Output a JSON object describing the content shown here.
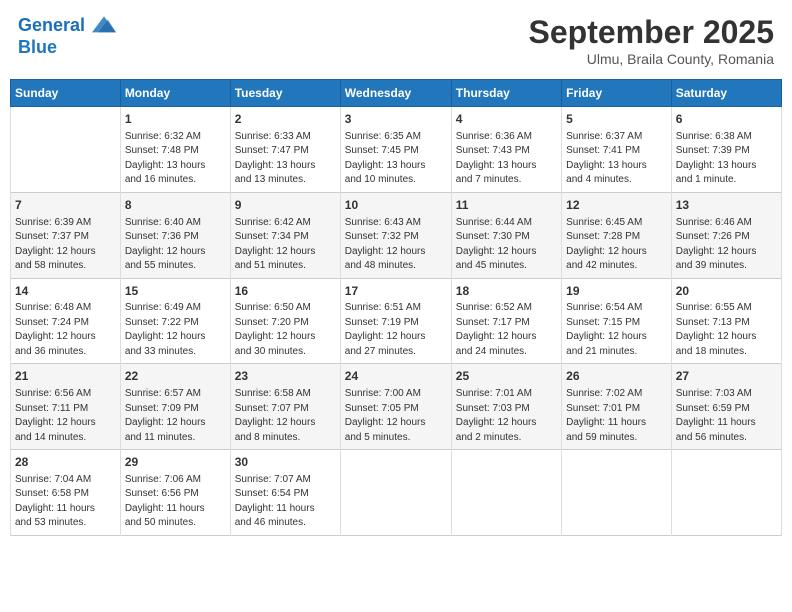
{
  "header": {
    "logo_line1": "General",
    "logo_line2": "Blue",
    "month_title": "September 2025",
    "location": "Ulmu, Braila County, Romania"
  },
  "days_of_week": [
    "Sunday",
    "Monday",
    "Tuesday",
    "Wednesday",
    "Thursday",
    "Friday",
    "Saturday"
  ],
  "weeks": [
    [
      {
        "day": "",
        "info": ""
      },
      {
        "day": "1",
        "info": "Sunrise: 6:32 AM\nSunset: 7:48 PM\nDaylight: 13 hours\nand 16 minutes."
      },
      {
        "day": "2",
        "info": "Sunrise: 6:33 AM\nSunset: 7:47 PM\nDaylight: 13 hours\nand 13 minutes."
      },
      {
        "day": "3",
        "info": "Sunrise: 6:35 AM\nSunset: 7:45 PM\nDaylight: 13 hours\nand 10 minutes."
      },
      {
        "day": "4",
        "info": "Sunrise: 6:36 AM\nSunset: 7:43 PM\nDaylight: 13 hours\nand 7 minutes."
      },
      {
        "day": "5",
        "info": "Sunrise: 6:37 AM\nSunset: 7:41 PM\nDaylight: 13 hours\nand 4 minutes."
      },
      {
        "day": "6",
        "info": "Sunrise: 6:38 AM\nSunset: 7:39 PM\nDaylight: 13 hours\nand 1 minute."
      }
    ],
    [
      {
        "day": "7",
        "info": "Sunrise: 6:39 AM\nSunset: 7:37 PM\nDaylight: 12 hours\nand 58 minutes."
      },
      {
        "day": "8",
        "info": "Sunrise: 6:40 AM\nSunset: 7:36 PM\nDaylight: 12 hours\nand 55 minutes."
      },
      {
        "day": "9",
        "info": "Sunrise: 6:42 AM\nSunset: 7:34 PM\nDaylight: 12 hours\nand 51 minutes."
      },
      {
        "day": "10",
        "info": "Sunrise: 6:43 AM\nSunset: 7:32 PM\nDaylight: 12 hours\nand 48 minutes."
      },
      {
        "day": "11",
        "info": "Sunrise: 6:44 AM\nSunset: 7:30 PM\nDaylight: 12 hours\nand 45 minutes."
      },
      {
        "day": "12",
        "info": "Sunrise: 6:45 AM\nSunset: 7:28 PM\nDaylight: 12 hours\nand 42 minutes."
      },
      {
        "day": "13",
        "info": "Sunrise: 6:46 AM\nSunset: 7:26 PM\nDaylight: 12 hours\nand 39 minutes."
      }
    ],
    [
      {
        "day": "14",
        "info": "Sunrise: 6:48 AM\nSunset: 7:24 PM\nDaylight: 12 hours\nand 36 minutes."
      },
      {
        "day": "15",
        "info": "Sunrise: 6:49 AM\nSunset: 7:22 PM\nDaylight: 12 hours\nand 33 minutes."
      },
      {
        "day": "16",
        "info": "Sunrise: 6:50 AM\nSunset: 7:20 PM\nDaylight: 12 hours\nand 30 minutes."
      },
      {
        "day": "17",
        "info": "Sunrise: 6:51 AM\nSunset: 7:19 PM\nDaylight: 12 hours\nand 27 minutes."
      },
      {
        "day": "18",
        "info": "Sunrise: 6:52 AM\nSunset: 7:17 PM\nDaylight: 12 hours\nand 24 minutes."
      },
      {
        "day": "19",
        "info": "Sunrise: 6:54 AM\nSunset: 7:15 PM\nDaylight: 12 hours\nand 21 minutes."
      },
      {
        "day": "20",
        "info": "Sunrise: 6:55 AM\nSunset: 7:13 PM\nDaylight: 12 hours\nand 18 minutes."
      }
    ],
    [
      {
        "day": "21",
        "info": "Sunrise: 6:56 AM\nSunset: 7:11 PM\nDaylight: 12 hours\nand 14 minutes."
      },
      {
        "day": "22",
        "info": "Sunrise: 6:57 AM\nSunset: 7:09 PM\nDaylight: 12 hours\nand 11 minutes."
      },
      {
        "day": "23",
        "info": "Sunrise: 6:58 AM\nSunset: 7:07 PM\nDaylight: 12 hours\nand 8 minutes."
      },
      {
        "day": "24",
        "info": "Sunrise: 7:00 AM\nSunset: 7:05 PM\nDaylight: 12 hours\nand 5 minutes."
      },
      {
        "day": "25",
        "info": "Sunrise: 7:01 AM\nSunset: 7:03 PM\nDaylight: 12 hours\nand 2 minutes."
      },
      {
        "day": "26",
        "info": "Sunrise: 7:02 AM\nSunset: 7:01 PM\nDaylight: 11 hours\nand 59 minutes."
      },
      {
        "day": "27",
        "info": "Sunrise: 7:03 AM\nSunset: 6:59 PM\nDaylight: 11 hours\nand 56 minutes."
      }
    ],
    [
      {
        "day": "28",
        "info": "Sunrise: 7:04 AM\nSunset: 6:58 PM\nDaylight: 11 hours\nand 53 minutes."
      },
      {
        "day": "29",
        "info": "Sunrise: 7:06 AM\nSunset: 6:56 PM\nDaylight: 11 hours\nand 50 minutes."
      },
      {
        "day": "30",
        "info": "Sunrise: 7:07 AM\nSunset: 6:54 PM\nDaylight: 11 hours\nand 46 minutes."
      },
      {
        "day": "",
        "info": ""
      },
      {
        "day": "",
        "info": ""
      },
      {
        "day": "",
        "info": ""
      },
      {
        "day": "",
        "info": ""
      }
    ]
  ]
}
